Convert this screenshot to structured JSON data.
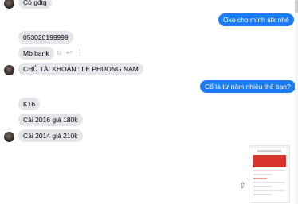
{
  "messages": {
    "m0": "Có gđtg",
    "m1": "Oke cho mình stk nhé",
    "m2": "053020199999",
    "m3": "Mb bank",
    "m4": "CHỦ TÀI KHOẢN : LE PHUONG NAM",
    "m5": "Cổ là từ năm nhiêu thế bạn?",
    "m6": "K16",
    "m7": "Cái 2016 giá 180k",
    "m8": "Cái 2014 giá 210k"
  },
  "colors": {
    "outgoing": "#1b7cf5",
    "incoming": "#e4e6eb",
    "attachment_header": "#d9342b"
  },
  "icons": {
    "react": "smiley-icon",
    "reply": "reply-icon",
    "more": "more-icon",
    "share": "share-icon"
  }
}
